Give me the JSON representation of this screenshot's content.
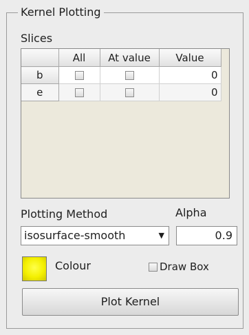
{
  "panel": {
    "title": "Kernel Plotting"
  },
  "slices": {
    "label": "Slices",
    "headers": [
      "",
      "All",
      "At value",
      "Value"
    ],
    "rows": [
      {
        "name": "b",
        "all": false,
        "at_value": false,
        "value": "0"
      },
      {
        "name": "e",
        "all": false,
        "at_value": false,
        "value": "0"
      }
    ]
  },
  "plotting": {
    "method_label": "Plotting Method",
    "method_value": "isosurface-smooth",
    "alpha_label": "Alpha",
    "alpha_value": "0.9"
  },
  "colour": {
    "label": "Colour",
    "swatch_color": "#f4f000"
  },
  "draw_box": {
    "label": "Draw Box",
    "checked": false
  },
  "plot_button": {
    "label": "Plot Kernel"
  },
  "icons": {
    "dropdown": "chevron-down-icon"
  }
}
